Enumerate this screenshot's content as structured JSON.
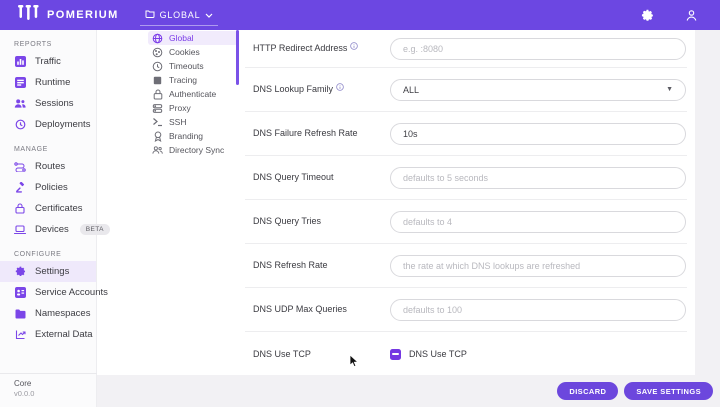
{
  "header": {
    "brand": "POMERIUM",
    "namespace_selector": {
      "label": "GLOBAL",
      "icon": "folder-icon"
    },
    "actions": [
      {
        "icon": "gear-icon"
      },
      {
        "icon": "user-icon"
      }
    ]
  },
  "sidebar": {
    "sections": [
      {
        "title": "REPORTS",
        "items": [
          {
            "label": "Traffic",
            "icon": "traffic-icon",
            "active": false
          },
          {
            "label": "Runtime",
            "icon": "runtime-icon",
            "active": false
          },
          {
            "label": "Sessions",
            "icon": "sessions-icon",
            "active": false
          },
          {
            "label": "Deployments",
            "icon": "deployments-icon",
            "active": false
          }
        ]
      },
      {
        "title": "MANAGE",
        "items": [
          {
            "label": "Routes",
            "icon": "routes-icon",
            "active": false
          },
          {
            "label": "Policies",
            "icon": "policies-icon",
            "active": false
          },
          {
            "label": "Certificates",
            "icon": "certificates-icon",
            "active": false
          },
          {
            "label": "Devices",
            "icon": "devices-icon",
            "badge": "BETA",
            "active": false
          }
        ]
      },
      {
        "title": "CONFIGURE",
        "items": [
          {
            "label": "Settings",
            "icon": "settings-icon",
            "active": true
          },
          {
            "label": "Service Accounts",
            "icon": "service-accounts-icon",
            "active": false
          },
          {
            "label": "Namespaces",
            "icon": "namespaces-icon",
            "active": false
          },
          {
            "label": "External Data",
            "icon": "external-data-icon",
            "active": false
          }
        ]
      }
    ],
    "footer": {
      "product": "Core",
      "version": "v0.0.0"
    }
  },
  "settings_nav": {
    "items": [
      {
        "label": "Global",
        "icon": "globe-icon",
        "active": true
      },
      {
        "label": "Cookies",
        "icon": "cookie-icon",
        "active": false
      },
      {
        "label": "Timeouts",
        "icon": "clock-icon",
        "active": false
      },
      {
        "label": "Tracing",
        "icon": "tracing-icon",
        "active": false
      },
      {
        "label": "Authenticate",
        "icon": "lock-icon",
        "active": false
      },
      {
        "label": "Proxy",
        "icon": "proxy-icon",
        "active": false
      },
      {
        "label": "SSH",
        "icon": "terminal-icon",
        "active": false
      },
      {
        "label": "Branding",
        "icon": "badge-icon",
        "active": false
      },
      {
        "label": "Directory Sync",
        "icon": "people-icon",
        "active": false
      }
    ]
  },
  "form": {
    "rows": [
      {
        "label": "HTTP Redirect Address",
        "has_info": true,
        "type": "input",
        "placeholder": "e.g. :8080",
        "value": ""
      },
      {
        "label": "DNS Lookup Family",
        "has_info": true,
        "type": "select",
        "value": "ALL"
      },
      {
        "label": "DNS Failure Refresh Rate",
        "has_info": false,
        "type": "input",
        "placeholder": "",
        "value": "10s"
      },
      {
        "label": "DNS Query Timeout",
        "has_info": false,
        "type": "input",
        "placeholder": "defaults to 5 seconds",
        "value": ""
      },
      {
        "label": "DNS Query Tries",
        "has_info": false,
        "type": "input",
        "placeholder": "defaults to 4",
        "value": ""
      },
      {
        "label": "DNS Refresh Rate",
        "has_info": false,
        "type": "input",
        "placeholder": "the rate at which DNS lookups are refreshed",
        "value": ""
      },
      {
        "label": "DNS UDP Max Queries",
        "has_info": false,
        "type": "input",
        "placeholder": "defaults to 100",
        "value": ""
      },
      {
        "label": "DNS Use TCP",
        "has_info": false,
        "type": "checkbox",
        "checkbox_label": "DNS Use TCP",
        "checked": true
      }
    ]
  },
  "footer_actions": {
    "discard": "DISCARD",
    "save": "SAVE SETTINGS"
  },
  "colors": {
    "header_bg": "#6C47E2",
    "accent": "#7B3FE4",
    "active_item_bg": "#EFE9FB",
    "button_bg": "#6C47DD",
    "checkbox_bg": "#7438E2",
    "footer_bg": "#F2F1F4"
  }
}
